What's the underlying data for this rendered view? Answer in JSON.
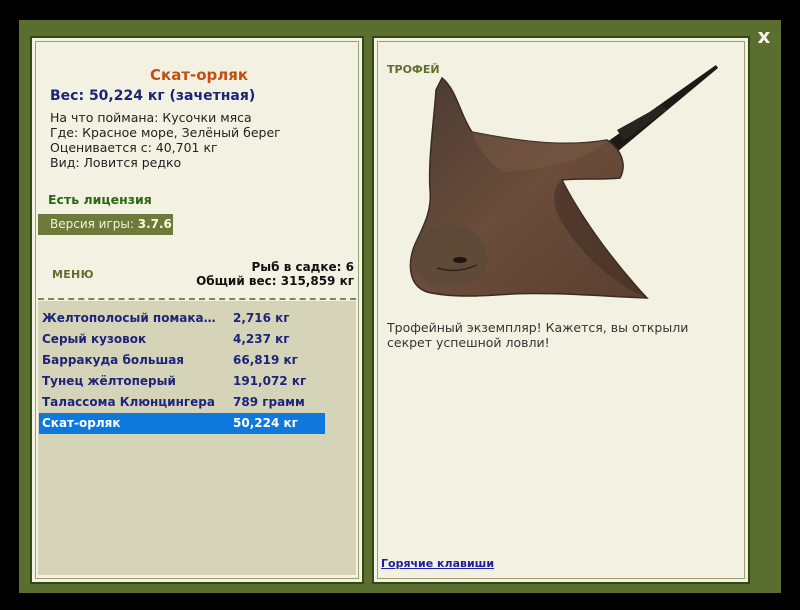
{
  "close_label": "x",
  "left": {
    "fish_name": "Скат-орляк",
    "weight_line": "Вес: 50,224 кг (зачетная)",
    "info": [
      "На что поймана: Кусочки мяса",
      "Где: Красное море, Зелёный берег",
      "Оценивается с: 40,701 кг",
      "Вид: Ловится редко"
    ],
    "license": "Есть лицензия",
    "version_label": "Версия игры:",
    "version_value": "3.7.6",
    "menu_label": "МЕНЮ",
    "cage_count": "Рыб в садке: 6",
    "cage_weight": "Общий вес: 315,859 кг",
    "catch_list": [
      {
        "name": "Желтополосый помакантус",
        "weight": "2,716 кг",
        "selected": false
      },
      {
        "name": "Серый кузовок",
        "weight": "4,237 кг",
        "selected": false
      },
      {
        "name": "Барракуда большая",
        "weight": "66,819 кг",
        "selected": false
      },
      {
        "name": "Тунец жёлтоперый",
        "weight": "191,072 кг",
        "selected": false
      },
      {
        "name": "Талассома Клюнцингера",
        "weight": "789 грамм",
        "selected": false
      },
      {
        "name": "Скат-орляк",
        "weight": "50,224 кг",
        "selected": true
      }
    ]
  },
  "right": {
    "trophy_label": "ТРОФЕЙ",
    "description": "Трофейный экземпляр! Кажется, вы открыли секрет успешной ловли!",
    "hotkeys_link": "Горячие клавиши"
  },
  "colors": {
    "frame": "#596e2f",
    "panel": "#f3f2e2",
    "list_bg": "#d5d4b8",
    "selected_row": "#0f78dc",
    "fish_title": "#c24e12",
    "weight_text": "#1a2478",
    "license_text": "#2a6812"
  }
}
